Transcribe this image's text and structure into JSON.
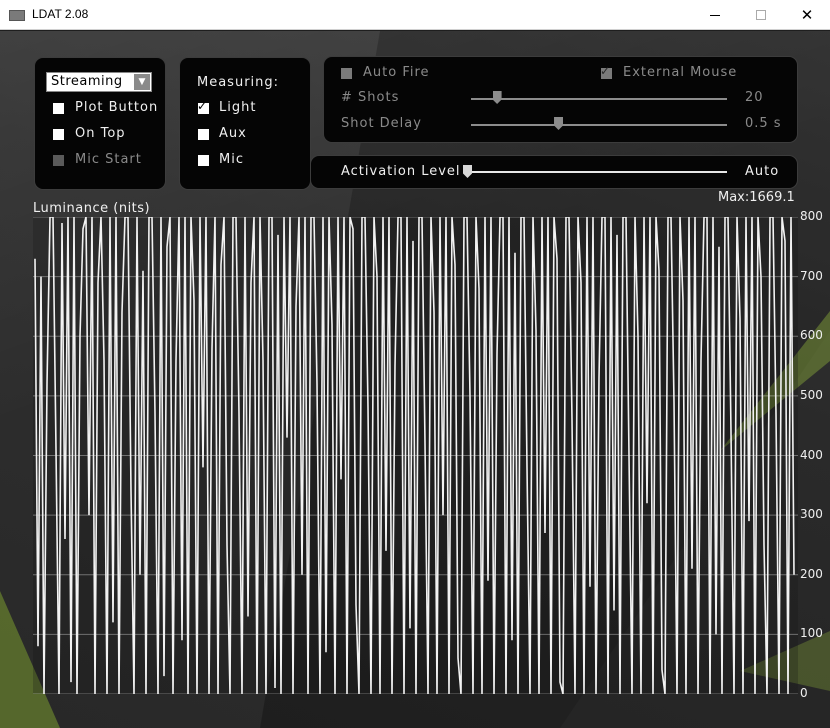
{
  "window": {
    "title": "LDAT 2.08",
    "icon": "app-icon",
    "controls": [
      "minimize",
      "maximize",
      "close"
    ]
  },
  "mode_panel": {
    "mode_select": "Streaming",
    "plot_button": {
      "label": "Plot Button",
      "checked": false
    },
    "on_top": {
      "label": "On Top",
      "checked": false
    },
    "mic_start": {
      "label": "Mic Start",
      "checked": false,
      "disabled": true
    }
  },
  "measuring_panel": {
    "heading": "Measuring:",
    "light": {
      "label": "Light",
      "checked": true
    },
    "aux": {
      "label": "Aux",
      "checked": false
    },
    "mic": {
      "label": "Mic",
      "checked": false
    }
  },
  "shots_panel": {
    "auto_fire": {
      "label": "Auto Fire",
      "checked": false,
      "disabled": true
    },
    "external_mouse": {
      "label": "External Mouse",
      "checked": true,
      "disabled": true
    },
    "shots": {
      "label": "# Shots",
      "value": "20",
      "slider_fraction": 0.1
    },
    "shot_delay": {
      "label": "Shot Delay",
      "value": "0.5 s",
      "slider_fraction": 0.34
    }
  },
  "activation_panel": {
    "label": "Activation Level",
    "value": "Auto",
    "slider_fraction": 0.0
  },
  "chart_data": {
    "type": "line",
    "title": "Luminance (nits)",
    "max_label": "Max:1669.1",
    "ylim": [
      0,
      800
    ],
    "yticks": [
      0,
      100,
      200,
      300,
      400,
      500,
      600,
      700,
      800
    ],
    "grid": true,
    "series": [
      {
        "values": [
          730,
          80,
          700,
          0,
          520,
          800,
          800,
          410,
          0,
          790,
          260,
          800,
          20,
          800,
          0,
          600,
          780,
          800,
          300,
          800,
          0,
          690,
          800,
          560,
          0,
          800,
          120,
          800,
          0,
          640,
          800,
          800,
          340,
          0,
          800,
          200,
          710,
          0,
          800,
          800,
          470,
          0,
          800,
          30,
          750,
          800,
          0,
          560,
          800,
          90,
          800,
          0,
          800,
          660,
          0,
          800,
          380,
          800,
          0,
          580,
          800,
          0,
          720,
          800,
          250,
          0,
          800,
          800,
          470,
          0,
          800,
          130,
          690,
          800,
          0,
          800,
          560,
          0,
          800,
          800,
          10,
          770,
          0,
          800,
          430,
          800,
          0,
          650,
          800,
          200,
          800,
          0,
          800,
          800,
          520,
          0,
          800,
          70,
          800,
          620,
          0,
          800,
          360,
          800,
          0,
          800,
          780,
          150,
          0,
          800,
          800,
          480,
          0,
          800,
          700,
          0,
          800,
          240,
          800,
          0,
          550,
          800,
          800,
          0,
          800,
          110,
          760,
          0,
          800,
          800,
          420,
          0,
          800,
          640,
          0,
          800,
          300,
          800,
          0,
          800,
          720,
          60,
          0,
          800,
          800,
          500,
          0,
          800,
          680,
          0,
          800,
          190,
          800,
          0,
          570,
          800,
          800,
          0,
          800,
          90,
          740,
          0,
          800,
          800,
          380,
          0,
          800,
          610,
          0,
          800,
          270,
          800,
          0,
          800,
          730,
          20,
          0,
          800,
          800,
          460,
          0,
          800,
          690,
          0,
          800,
          180,
          800,
          0,
          530,
          800,
          800,
          0,
          800,
          140,
          770,
          0,
          800,
          800,
          400,
          0,
          800,
          600,
          0,
          800,
          320,
          800,
          0,
          800,
          710,
          40,
          0,
          800,
          800,
          490,
          0,
          800,
          660,
          0,
          800,
          210,
          800,
          0,
          560,
          800,
          800,
          0,
          800,
          100,
          750,
          0,
          800,
          800,
          440,
          0,
          800,
          630,
          0,
          800,
          290,
          800,
          0,
          800,
          700,
          250,
          0,
          800,
          800,
          470,
          0,
          800,
          760,
          0,
          800,
          200
        ]
      }
    ]
  }
}
